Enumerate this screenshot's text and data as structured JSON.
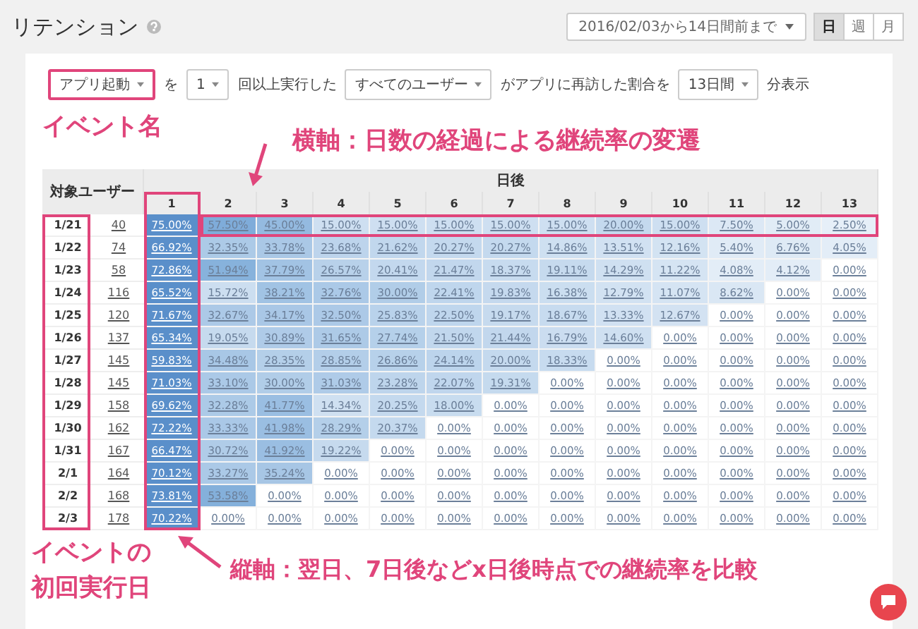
{
  "page": {
    "title": "リテンション"
  },
  "date_range": {
    "value": "2016/02/03から14日間前まで"
  },
  "period_buttons": [
    {
      "label": "日",
      "selected": true
    },
    {
      "label": "週",
      "selected": false
    },
    {
      "label": "月",
      "selected": false
    }
  ],
  "query": [
    {
      "kind": "select",
      "value": "アプリ起動",
      "highlighted": true
    },
    {
      "kind": "text",
      "value": "を"
    },
    {
      "kind": "select",
      "value": "1",
      "highlighted": false
    },
    {
      "kind": "text",
      "value": "回以上実行した"
    },
    {
      "kind": "select",
      "value": "すべてのユーザー",
      "highlighted": false
    },
    {
      "kind": "text",
      "value": "がアプリに再訪した割合を"
    },
    {
      "kind": "select",
      "value": "13日間",
      "highlighted": false
    },
    {
      "kind": "text",
      "value": "分表示"
    }
  ],
  "annotations": {
    "event_name": "イベント名",
    "horizontal": "横軸：日数の経過による継続率の変遷",
    "first_run": [
      "イベントの",
      "初回実行日"
    ],
    "vertical": "縦軸：翌日、7日後などx日後時点での継続率を比較"
  },
  "table": {
    "cohort_header": "対象ユーザー",
    "days_header": "日後",
    "day_columns": [
      "1",
      "2",
      "3",
      "4",
      "5",
      "6",
      "7",
      "8",
      "9",
      "10",
      "11",
      "12",
      "13"
    ],
    "rows": [
      {
        "date": "1/21",
        "users": "40",
        "values": [
          "75.00%",
          "57.50%",
          "45.00%",
          "15.00%",
          "15.00%",
          "15.00%",
          "15.00%",
          "15.00%",
          "20.00%",
          "15.00%",
          "7.50%",
          "5.00%",
          "2.50%"
        ]
      },
      {
        "date": "1/22",
        "users": "74",
        "values": [
          "66.92%",
          "32.35%",
          "33.78%",
          "23.68%",
          "21.62%",
          "20.27%",
          "20.27%",
          "14.86%",
          "13.51%",
          "12.16%",
          "5.40%",
          "6.76%",
          "4.05%"
        ]
      },
      {
        "date": "1/23",
        "users": "58",
        "values": [
          "72.86%",
          "51.94%",
          "37.79%",
          "26.57%",
          "20.41%",
          "21.47%",
          "18.37%",
          "19.11%",
          "14.29%",
          "11.22%",
          "4.08%",
          "4.12%",
          "0.00%"
        ]
      },
      {
        "date": "1/24",
        "users": "116",
        "values": [
          "65.52%",
          "15.72%",
          "38.21%",
          "32.76%",
          "30.00%",
          "22.41%",
          "19.83%",
          "16.38%",
          "12.79%",
          "11.07%",
          "8.62%",
          "0.00%",
          "0.00%"
        ]
      },
      {
        "date": "1/25",
        "users": "120",
        "values": [
          "71.67%",
          "32.67%",
          "34.17%",
          "32.50%",
          "25.83%",
          "22.50%",
          "19.17%",
          "18.67%",
          "13.33%",
          "12.67%",
          "0.00%",
          "0.00%",
          "0.00%"
        ]
      },
      {
        "date": "1/26",
        "users": "137",
        "values": [
          "65.34%",
          "19.05%",
          "30.89%",
          "31.65%",
          "27.74%",
          "21.50%",
          "21.44%",
          "16.79%",
          "14.60%",
          "0.00%",
          "0.00%",
          "0.00%",
          "0.00%"
        ]
      },
      {
        "date": "1/27",
        "users": "145",
        "values": [
          "59.83%",
          "34.48%",
          "28.35%",
          "28.85%",
          "26.86%",
          "24.14%",
          "20.00%",
          "18.33%",
          "0.00%",
          "0.00%",
          "0.00%",
          "0.00%",
          "0.00%"
        ]
      },
      {
        "date": "1/28",
        "users": "145",
        "values": [
          "71.03%",
          "33.10%",
          "30.00%",
          "31.03%",
          "23.28%",
          "22.07%",
          "19.31%",
          "0.00%",
          "0.00%",
          "0.00%",
          "0.00%",
          "0.00%",
          "0.00%"
        ]
      },
      {
        "date": "1/29",
        "users": "158",
        "values": [
          "69.62%",
          "32.28%",
          "41.77%",
          "14.34%",
          "20.25%",
          "18.00%",
          "0.00%",
          "0.00%",
          "0.00%",
          "0.00%",
          "0.00%",
          "0.00%",
          "0.00%"
        ]
      },
      {
        "date": "1/30",
        "users": "162",
        "values": [
          "72.22%",
          "33.33%",
          "41.98%",
          "28.29%",
          "20.37%",
          "0.00%",
          "0.00%",
          "0.00%",
          "0.00%",
          "0.00%",
          "0.00%",
          "0.00%",
          "0.00%"
        ]
      },
      {
        "date": "1/31",
        "users": "167",
        "values": [
          "66.47%",
          "30.72%",
          "41.92%",
          "19.22%",
          "0.00%",
          "0.00%",
          "0.00%",
          "0.00%",
          "0.00%",
          "0.00%",
          "0.00%",
          "0.00%",
          "0.00%"
        ]
      },
      {
        "date": "2/1",
        "users": "164",
        "values": [
          "70.12%",
          "33.27%",
          "35.24%",
          "0.00%",
          "0.00%",
          "0.00%",
          "0.00%",
          "0.00%",
          "0.00%",
          "0.00%",
          "0.00%",
          "0.00%",
          "0.00%"
        ]
      },
      {
        "date": "2/2",
        "users": "168",
        "values": [
          "73.81%",
          "53.58%",
          "0.00%",
          "0.00%",
          "0.00%",
          "0.00%",
          "0.00%",
          "0.00%",
          "0.00%",
          "0.00%",
          "0.00%",
          "0.00%",
          "0.00%"
        ]
      },
      {
        "date": "2/3",
        "users": "178",
        "values": [
          "70.22%",
          "0.00%",
          "0.00%",
          "0.00%",
          "0.00%",
          "0.00%",
          "0.00%",
          "0.00%",
          "0.00%",
          "0.00%",
          "0.00%",
          "0.00%",
          "0.00%"
        ]
      }
    ]
  }
}
